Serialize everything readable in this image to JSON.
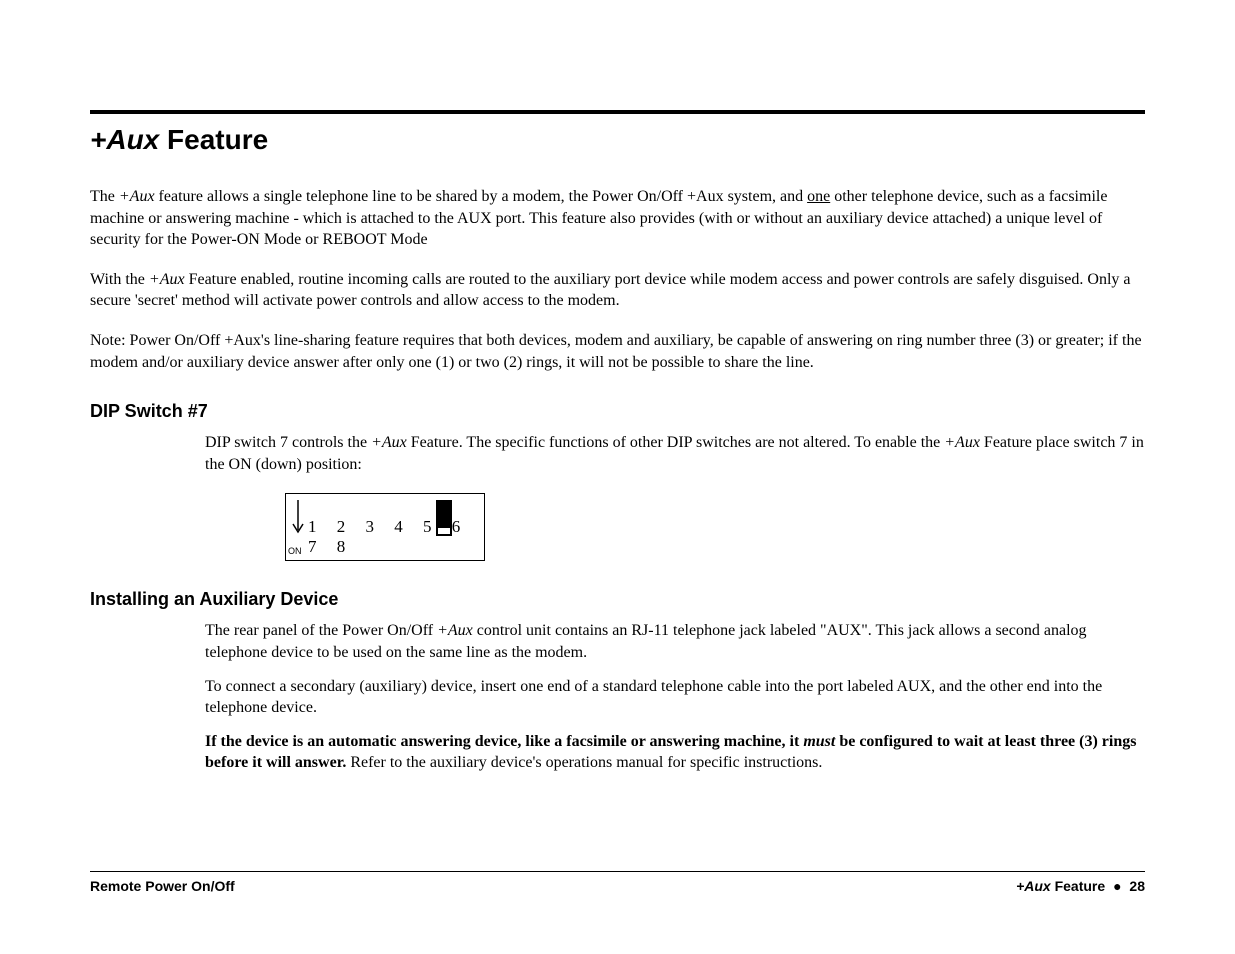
{
  "title_prefix": "+Aux",
  "title_suffix": " Feature",
  "para1_a": "The ",
  "para1_aux": "+Aux",
  "para1_b": " feature allows a single telephone line to be shared by a modem, the Power On/Off +Aux system, and ",
  "para1_one": "one",
  "para1_c": " other telephone device, such as a facsimile machine or answering machine - which is attached to the A",
  "para1_ux1": "UX",
  "para1_d": " port.  This feature also provides (with or without an auxiliary device attached) a unique level of security for the Power-ON Mode or ",
  "para1_re": "RE",
  "para1_e": "BOOT Mode",
  "para2_a": "With the ",
  "para2_aux": "+Aux",
  "para2_b": " Feature enabled, routine incoming calls are routed to the auxiliary port device while modem access and power controls are safely disguised.  Only a secure 'secret' method will activate power controls and allow access to the modem.",
  "para3": "Note:  Power On/Off +Aux's line-sharing feature requires that both devices, modem and auxiliary, be capable of answering on ring number three (3) or greater; if the modem and/or auxiliary device answer after only one (1) or two (2) rings, it will not be possible to share the line.",
  "section1": "DIP Switch #7",
  "s1p1_a": "DIP switch 7 controls the ",
  "s1p1_aux": "+Aux",
  "s1p1_b": " Feature.  The specific functions of other DIP switches are not altered.  To enable the ",
  "s1p1_aux2": "+Aux",
  "s1p1_c": " Feature place switch 7 in the ON (down) position:",
  "dip": {
    "on_label": "ON",
    "numbers": "1 2 3 4 5 6 7 8",
    "active_switch": 7
  },
  "section2": "Installing an Auxiliary Device",
  "s2p1_a": "The rear panel of the Power On/Off ",
  "s2p1_aux": "+Aux",
  "s2p1_b": " control unit contains an RJ-11 telephone jack labeled \"A",
  "s2p1_ux": "UX",
  "s2p1_c": "\".  This jack allows a second analog telephone device to be used on the same line as the modem.",
  "s2p2_a": "To connect a secondary (auxiliary) device, insert one end of a standard telephone cable into the port labeled A",
  "s2p2_ux": "UX",
  "s2p2_b": ", and the other end into the telephone device.",
  "s2p3_bold_a": "If the device is an automatic answering device, like a facsimile or answering machine, it ",
  "s2p3_must": "must",
  "s2p3_bold_b": " be configured to wait at least three (3) rings before it will answer.",
  "s2p3_rest": "  Refer to the auxiliary device's operations manual for specific instructions.",
  "footer": {
    "left": "Remote Power On/Off",
    "right_aux": "+Aux",
    "right_feature": " Feature",
    "dot": "●",
    "page": "28"
  }
}
